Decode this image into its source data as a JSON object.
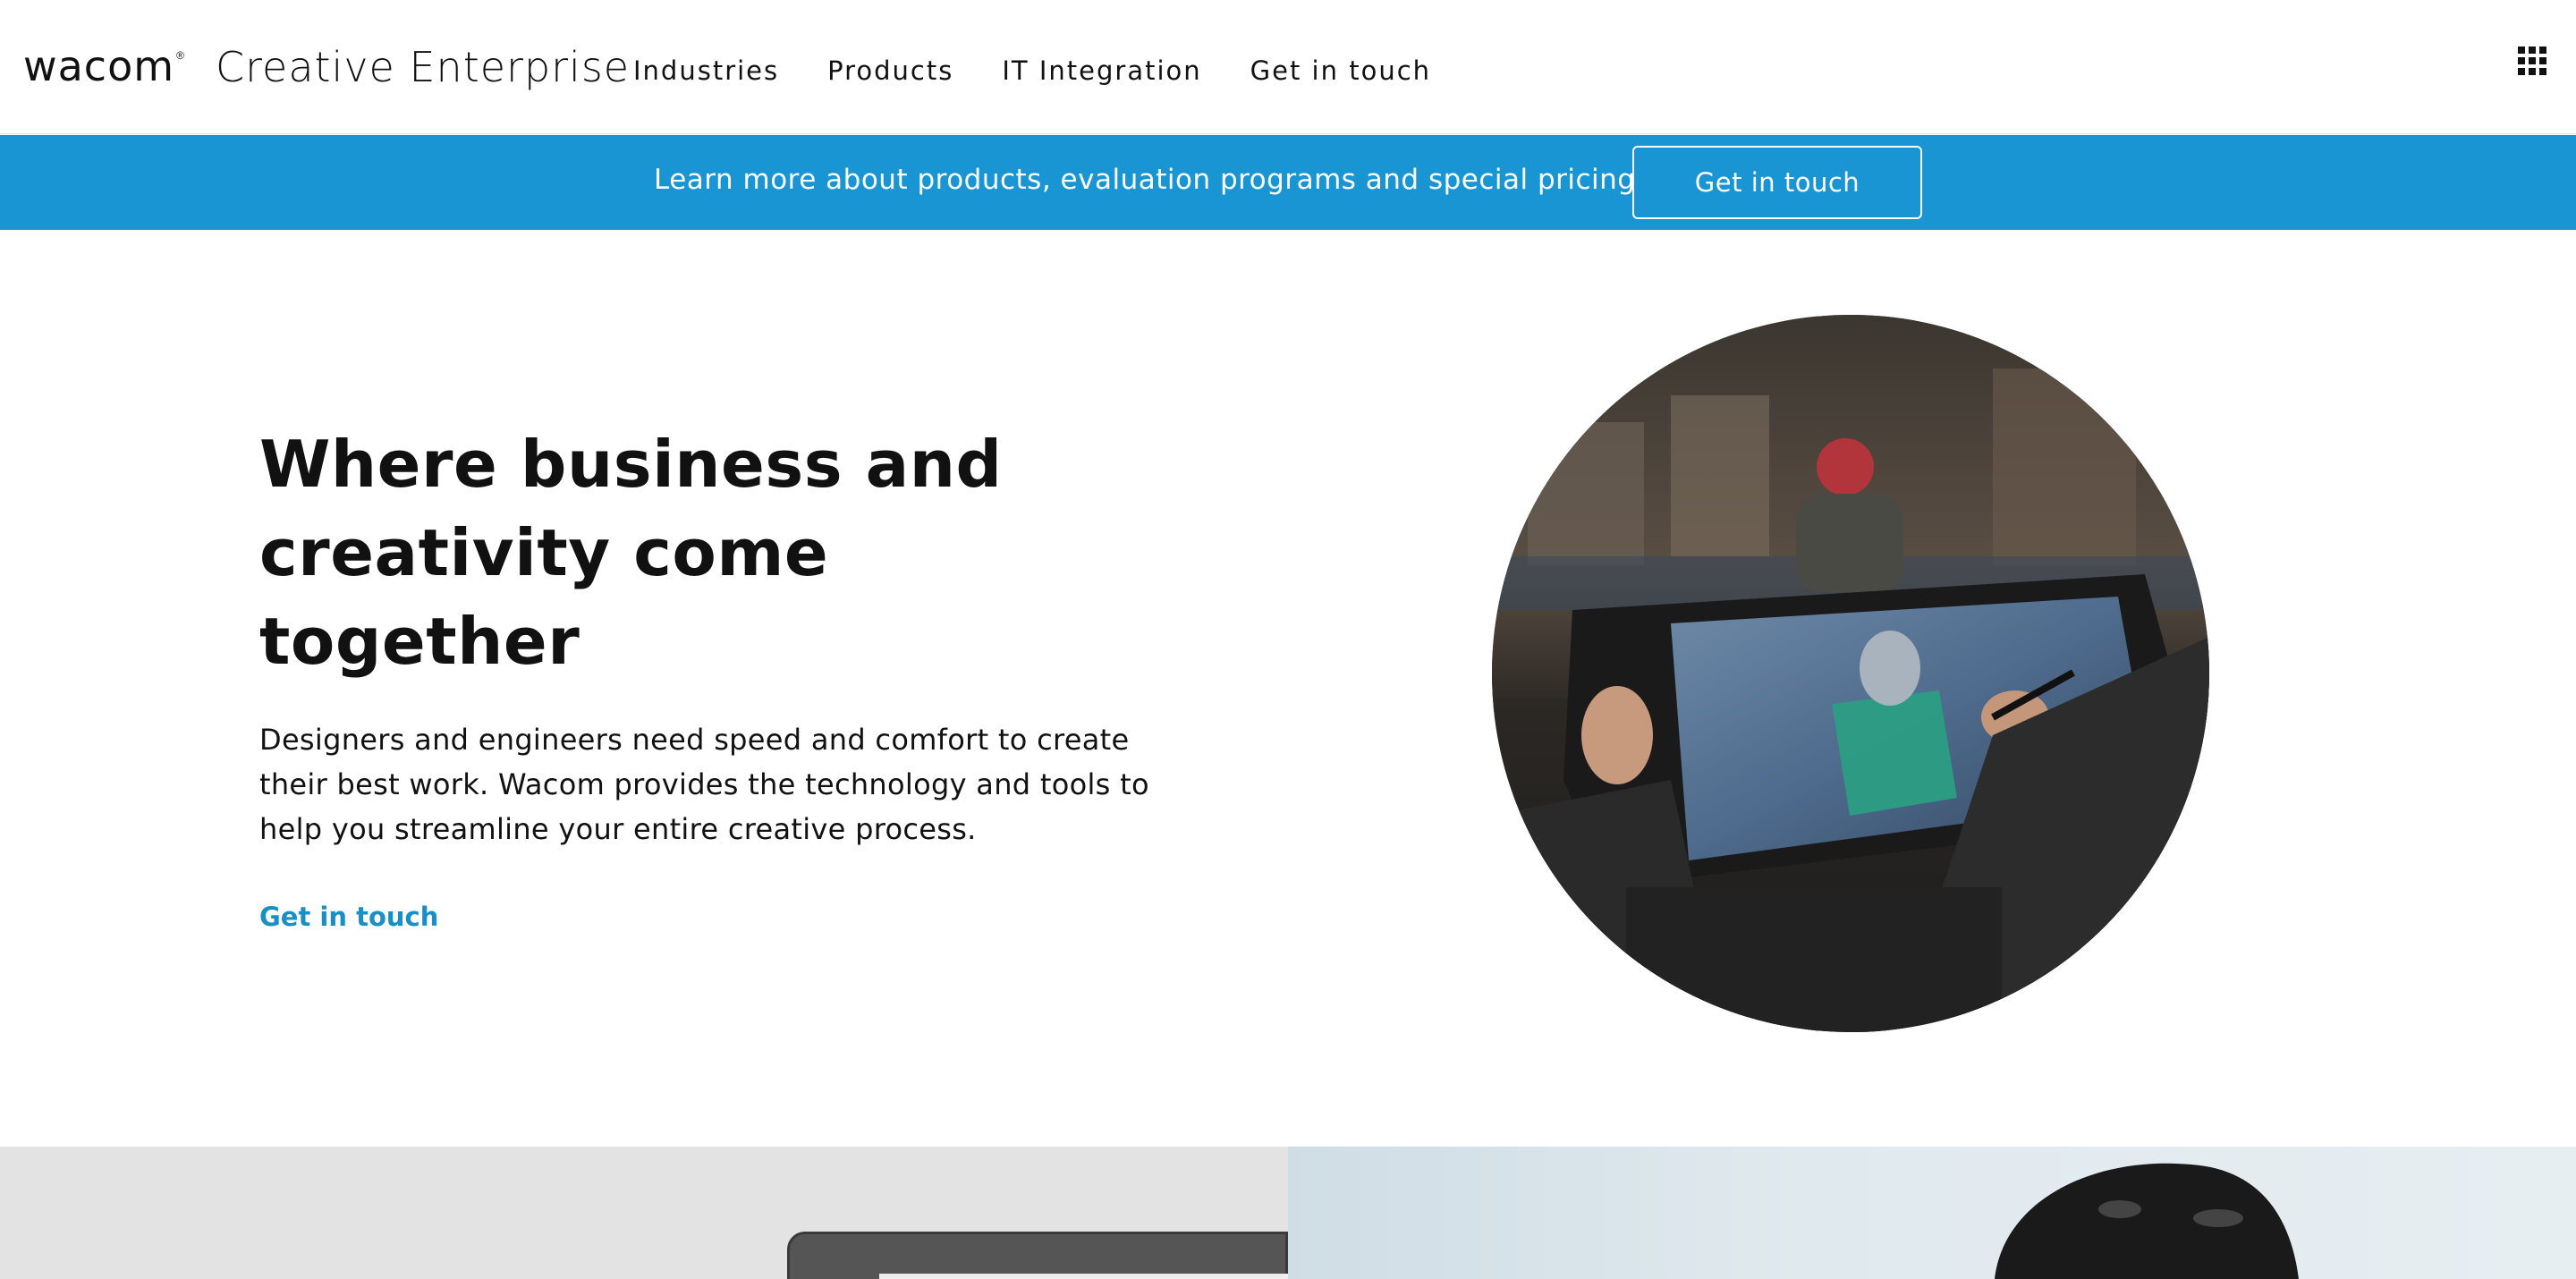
{
  "header": {
    "logo": "wacom",
    "product_name": "Creative Enterprise",
    "nav": [
      "Industries",
      "Products",
      "IT Integration",
      "Get in touch"
    ],
    "apps_icon": "grid-apps-icon"
  },
  "banner": {
    "text": "Learn more about products, evaluation programs and special pricing",
    "button_label": "Get in touch",
    "background_color": "#1a95d3"
  },
  "hero": {
    "title": "Where business and creativity come together",
    "description": "Designers and engineers need speed and comfort to create their best work. Wacom provides the technology and tools to help you streamline your entire creative process.",
    "link_label": "Get in touch",
    "link_color": "#1a8fc4"
  }
}
